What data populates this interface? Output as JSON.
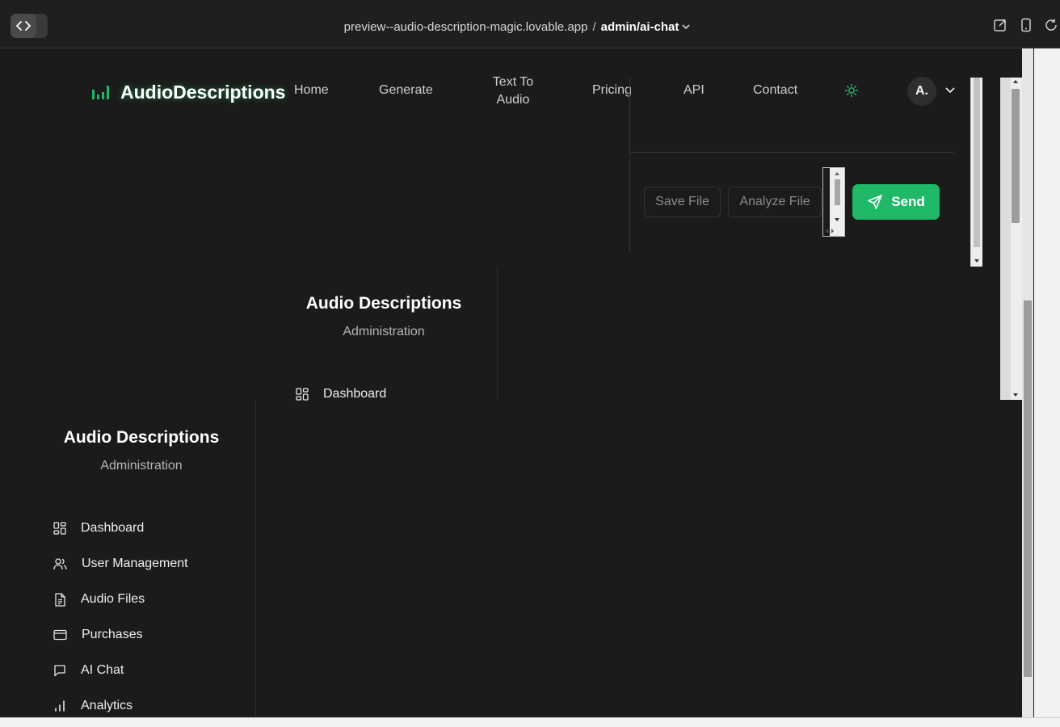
{
  "browser": {
    "url_host": "preview--audio-description-magic.lovable.app",
    "url_separator": "/",
    "url_path": "admin/ai-chat"
  },
  "header": {
    "logo_text": "AudioDescriptions",
    "nav": [
      "Home",
      "Generate",
      "Text To Audio",
      "Pricing",
      "API",
      "Contact"
    ],
    "avatar_text": "A."
  },
  "chat": {
    "save_label": "Save File",
    "analyze_label": "Analyze File",
    "send_label": "Send"
  },
  "nested_sidebar": {
    "title": "Audio Descriptions",
    "subtitle": "Administration",
    "first_item": "Dashboard"
  },
  "sidebar": {
    "title": "Audio Descriptions",
    "subtitle": "Administration",
    "items": [
      {
        "label": "Dashboard",
        "icon": "dashboard-icon"
      },
      {
        "label": "User Management",
        "icon": "users-icon"
      },
      {
        "label": "Audio Files",
        "icon": "file-text-icon"
      },
      {
        "label": "Purchases",
        "icon": "credit-card-icon"
      },
      {
        "label": "AI Chat",
        "icon": "message-square-icon"
      },
      {
        "label": "Analytics",
        "icon": "bar-chart-icon"
      }
    ]
  },
  "colors": {
    "accent": "#1fb866",
    "background": "#1b1b1b",
    "border": "#27332c"
  }
}
